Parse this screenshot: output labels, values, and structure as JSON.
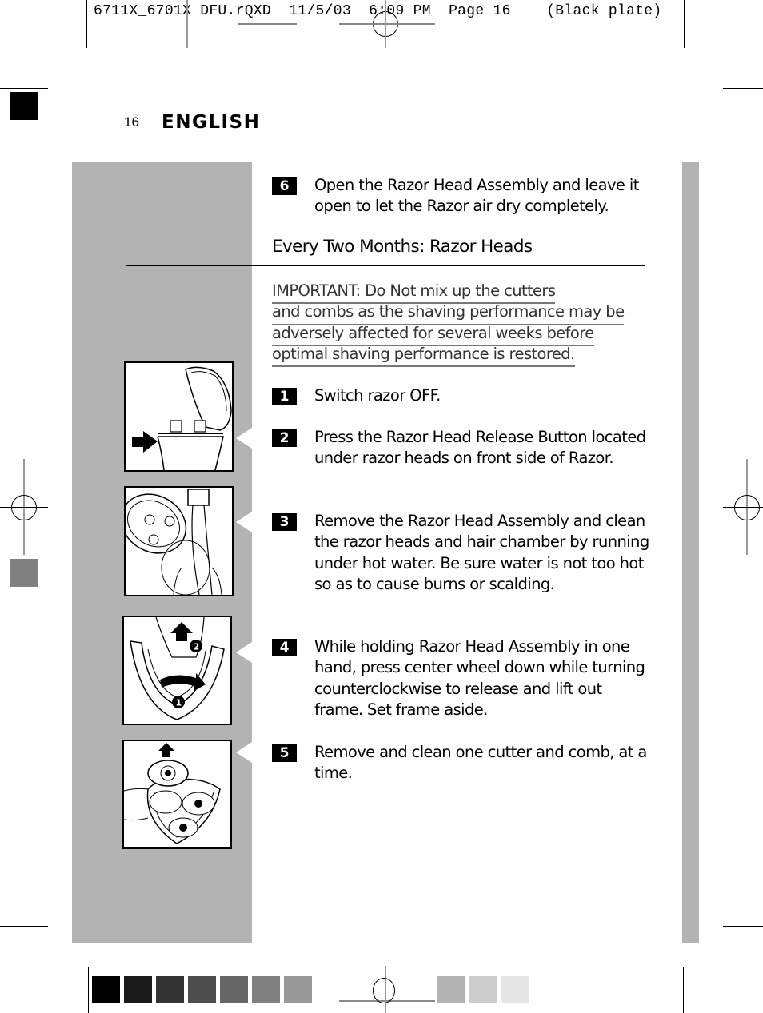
{
  "slug": {
    "text": "6711X_6701X DFU.rQXD  11/5/03  6:09 PM  Page 16    (Black plate)"
  },
  "page": {
    "number": "16",
    "language": "ENGLISH"
  },
  "intro_step": {
    "number": "6",
    "text": "Open the Razor Head Assembly and leave it open to let the Razor air dry completely."
  },
  "section": {
    "heading": "Every Two Months: Razor Heads",
    "important_lines": [
      "IMPORTANT: Do Not mix up the cutters",
      "and combs as the shaving performance may be",
      "adversely affected for several weeks before",
      "optimal shaving performance is restored."
    ],
    "steps": [
      {
        "number": "1",
        "text": "Switch razor OFF."
      },
      {
        "number": "2",
        "text": "Press the Razor Head Release Button located under razor heads on front side of Razor."
      },
      {
        "number": "3",
        "text": "Remove the Razor Head Assembly and clean the razor heads and hair chamber by running under hot water. Be sure water is not too hot so as to cause burns or scalding."
      },
      {
        "number": "4",
        "text": "While holding Razor Head Assembly in one hand, press center wheel down while turning counterclockwise to release and lift out frame. Set frame aside."
      },
      {
        "number": "5",
        "text": "Remove and clean one cutter and comb, at a time."
      }
    ]
  },
  "illustrations": [
    {
      "icon": "razor-open-head-release-illustration",
      "caption_markers": []
    },
    {
      "icon": "razor-rinse-under-tap-illustration",
      "caption_markers": []
    },
    {
      "icon": "frame-remove-illustration",
      "caption_markers": [
        "1",
        "2"
      ]
    },
    {
      "icon": "cutter-remove-illustration",
      "caption_markers": []
    }
  ],
  "colors": {
    "panel_gray": "#b3b3b3",
    "text_black": "#000000",
    "important_gray": "#333333",
    "step_badge_bg": "#000000",
    "step_badge_fg": "#ffffff"
  },
  "color_bar": {
    "swatches": [
      "#000000",
      "#1a1a1a",
      "#333333",
      "#4d4d4d",
      "#666666",
      "#808080",
      "#999999",
      "#b3b3b3",
      "#cccccc",
      "#e6e6e6"
    ]
  },
  "side_marks": {
    "top_left_swatch": "#000000",
    "mid_left_swatch": "#808080"
  }
}
